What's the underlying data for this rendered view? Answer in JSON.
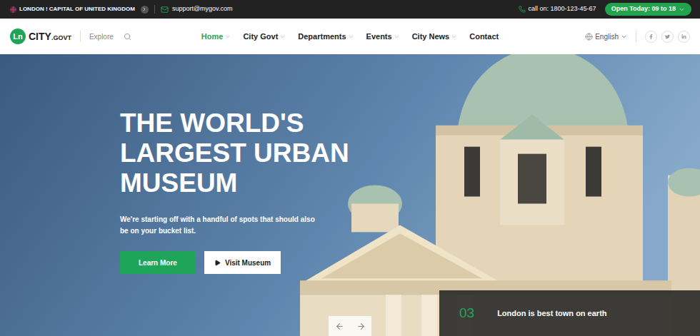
{
  "top_bar": {
    "location": "LONDON ! CAPITAL OF UNITED KINGDOM",
    "email": "support@mygov.com",
    "phone": "call on: 1800-123-45-67",
    "hours": "Open Today: 09 to 18"
  },
  "logo": {
    "mark": "Ln",
    "name": "CITY",
    "suffix": ".GOVT"
  },
  "search": {
    "label": "Explore"
  },
  "menu": [
    {
      "label": "Home",
      "selected": true,
      "dropdown": true
    },
    {
      "label": "City Govt",
      "selected": false,
      "dropdown": true
    },
    {
      "label": "Departments",
      "selected": false,
      "dropdown": true
    },
    {
      "label": "Events",
      "selected": false,
      "dropdown": true
    },
    {
      "label": "City News",
      "selected": false,
      "dropdown": true
    },
    {
      "label": "Contact",
      "selected": false,
      "dropdown": false
    }
  ],
  "language": "English",
  "hero": {
    "title_lines": [
      "THE WORLD'S",
      "LARGEST URBAN",
      "MUSEUM"
    ],
    "subtitle": "We're starting off with a handful of spots that should also be on your bucket list.",
    "buttons": [
      {
        "label": "Learn More",
        "kind": "primary"
      },
      {
        "label": "Visit Museum",
        "kind": "secondary"
      }
    ]
  },
  "slide": {
    "number": "03",
    "caption": "London is best town on earth"
  }
}
